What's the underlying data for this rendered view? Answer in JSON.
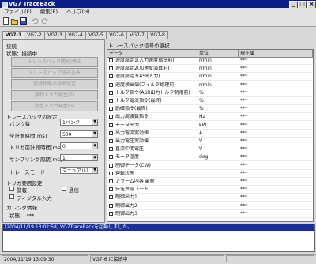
{
  "window": {
    "title": "VG7 TraceBack"
  },
  "menu": [
    "ファイル(F)",
    "編集(E)",
    "ヘルプ(H)"
  ],
  "tabs": [
    "VG7-1",
    "VG7-2",
    "VG7-3",
    "VG7-4",
    "VG7-5",
    "VG7-6",
    "VG7-7",
    "VG7-8"
  ],
  "left": {
    "connect_group": "接続",
    "status_label": "状態：接続中",
    "buttons": [
      "トレースバック開始/停止",
      "トレースバック読み込み",
      "接続状態の詳細設定",
      "強制トリガ発生(T)",
      "指定トリガ発生(S)"
    ],
    "settings_title": "トレースバックの設定",
    "fields": [
      {
        "label": "バンク数",
        "value": "1バンク"
      },
      {
        "label": "全計測時間[ms]",
        "value": "500"
      },
      {
        "label": "トリガ前計測時間[ms]",
        "value": "0"
      },
      {
        "label": "サンプリング周期[ms]",
        "value": "1"
      },
      {
        "label": "トレースモード",
        "value": "マニュアル1"
      }
    ],
    "trigger_title": "トリガ要因設定",
    "triggers": [
      "警報",
      "通信",
      "ディジタル入力"
    ],
    "calendar_title": "カレンダ情報",
    "calendar_state": "状態： ***"
  },
  "grid": {
    "title": "トレースバック信号の選択",
    "headers": [
      "データ",
      "単位",
      "現在値"
    ],
    "rows": [
      {
        "name": "速度設定1(入力速度指令前)",
        "unit": "r/min",
        "value": "***"
      },
      {
        "name": "速度設定2(加速度演算前)",
        "unit": "r/min",
        "value": "***"
      },
      {
        "name": "速度設定3(ASR入力)",
        "unit": "r/min",
        "value": "***"
      },
      {
        "name": "速度検出値(フィルタ処理前)",
        "unit": "r/min",
        "value": "***"
      },
      {
        "name": "トルク指令(ASR出力トルク制限前)",
        "unit": "%",
        "value": "***"
      },
      {
        "name": "トルク電流指令(最終)",
        "unit": "%",
        "value": "***"
      },
      {
        "name": "励磁指令(最終)",
        "unit": "%",
        "value": "***"
      },
      {
        "name": "出力周波数指令",
        "unit": "Hz",
        "value": "***"
      },
      {
        "name": "モータ出力",
        "unit": "kW",
        "value": "***"
      },
      {
        "name": "出力電流実効値",
        "unit": "A",
        "value": "***"
      },
      {
        "name": "出力電圧実効値",
        "unit": "V",
        "value": "***"
      },
      {
        "name": "直流中間電圧",
        "unit": "V",
        "value": "***"
      },
      {
        "name": "モータ温度",
        "unit": "deg",
        "value": "***"
      },
      {
        "name": "制御データ(CW)",
        "unit": "",
        "value": "***"
      },
      {
        "name": "運転状態",
        "unit": "",
        "value": "***"
      },
      {
        "name": "アラーム内容 最新",
        "unit": "",
        "value": "***"
      },
      {
        "name": "伝送異常コード",
        "unit": "",
        "value": "***"
      },
      {
        "name": "制御出力1",
        "unit": "",
        "value": "***"
      },
      {
        "name": "制御出力2",
        "unit": "",
        "value": "***"
      },
      {
        "name": "制御出力3",
        "unit": "",
        "value": "***"
      }
    ]
  },
  "log": {
    "line": "[2004/11/19 13:02:58] VG7TraceBackを起動しました。"
  },
  "status": {
    "datetime": "2004/11/19 13:09:30",
    "conn": "VG7-6 に接続中"
  }
}
